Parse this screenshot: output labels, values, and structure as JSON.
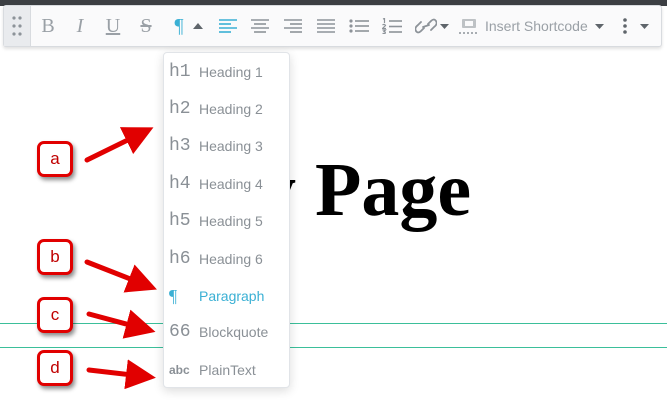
{
  "page": {
    "title_fragment": "y Page"
  },
  "toolbar": {
    "bold": "B",
    "italic": "I",
    "underline": "U",
    "strike": "S",
    "paragraph_glyph": "¶",
    "insert_shortcode": "Insert Shortcode",
    "accent_color": "#3ab0d4"
  },
  "format_menu": {
    "items": [
      {
        "icon": "h1",
        "label": "Heading 1"
      },
      {
        "icon": "h2",
        "label": "Heading 2"
      },
      {
        "icon": "h3",
        "label": "Heading 3"
      },
      {
        "icon": "h4",
        "label": "Heading 4"
      },
      {
        "icon": "h5",
        "label": "Heading 5"
      },
      {
        "icon": "h6",
        "label": "Heading 6"
      },
      {
        "icon": "¶",
        "label": "Paragraph",
        "selected": true
      },
      {
        "icon": "66",
        "label": "Blockquote"
      },
      {
        "icon": "abc",
        "label": "PlainText"
      }
    ]
  },
  "annotations": {
    "labels": [
      "a",
      "b",
      "c",
      "d"
    ],
    "color": "#e10000"
  }
}
